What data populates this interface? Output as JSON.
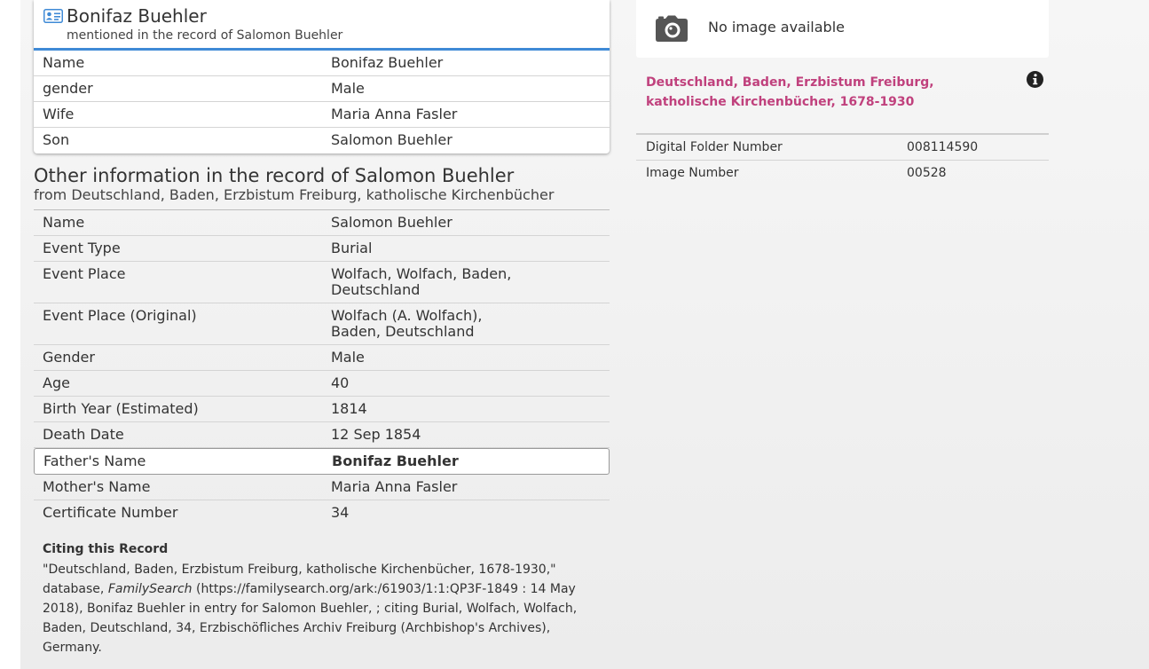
{
  "person_card": {
    "name": "Bonifaz Buehler",
    "subtitle": "mentioned in the record of Salomon Buehler",
    "rows": [
      {
        "label": "Name",
        "value": "Bonifaz Buehler"
      },
      {
        "label": "gender",
        "value": "Male"
      },
      {
        "label": "Wife",
        "value": "Maria Anna Fasler"
      },
      {
        "label": "Son",
        "value": "Salomon Buehler"
      }
    ]
  },
  "other_info": {
    "title": "Other information in the record of Salomon Buehler",
    "subtitle": "from Deutschland, Baden, Erzbistum Freiburg, katholische Kirchenbücher",
    "rows": [
      {
        "label": "Name",
        "value": "Salomon Buehler"
      },
      {
        "label": "Event Type",
        "value": "Burial"
      },
      {
        "label": "Event Place",
        "value": "Wolfach, Wolfach, Baden, Deutschland"
      },
      {
        "label": "Event Place (Original)",
        "value": "Wolfach (A. Wolfach), Baden, Deutschland"
      },
      {
        "label": "Gender",
        "value": "Male"
      },
      {
        "label": "Age",
        "value": "40"
      },
      {
        "label": "Birth Year (Estimated)",
        "value": "1814"
      },
      {
        "label": "Death Date",
        "value": "12 Sep 1854"
      },
      {
        "label": "Father's Name",
        "value": "Bonifaz Buehler"
      },
      {
        "label": "Mother's Name",
        "value": "Maria Anna Fasler"
      },
      {
        "label": "Certificate Number",
        "value": "34"
      }
    ]
  },
  "citing": {
    "title": "Citing this Record",
    "text_before": "\"Deutschland, Baden, Erzbistum Freiburg, katholische Kirchenbücher, 1678-1930,\" database, ",
    "site_name": "FamilySearch",
    "text_after": " (https://familysearch.org/ark:/61903/1:1:QP3F-1849 : 14 May 2018), Bonifaz Buehler in entry for Salomon Buehler, ; citing Burial, Wolfach, Wolfach, Baden, Deutschland, 34, Erzbischöfliches Archiv Freiburg (Archbishop's Archives), Germany."
  },
  "image_panel": {
    "no_image_text": "No image available",
    "collection_title": "Deutschland, Baden, Erzbistum Freiburg, katholische Kirchenbücher, 1678-1930",
    "rows": [
      {
        "label": "Digital Folder Number",
        "value": "008114590"
      },
      {
        "label": "Image Number",
        "value": "00528"
      }
    ]
  },
  "colors": {
    "accent_blue": "#3f8ad6",
    "link": "#2f6fc2",
    "collection_title": "#c0417d"
  },
  "icons": [
    "person-card-icon",
    "camera-icon",
    "info-icon"
  ]
}
